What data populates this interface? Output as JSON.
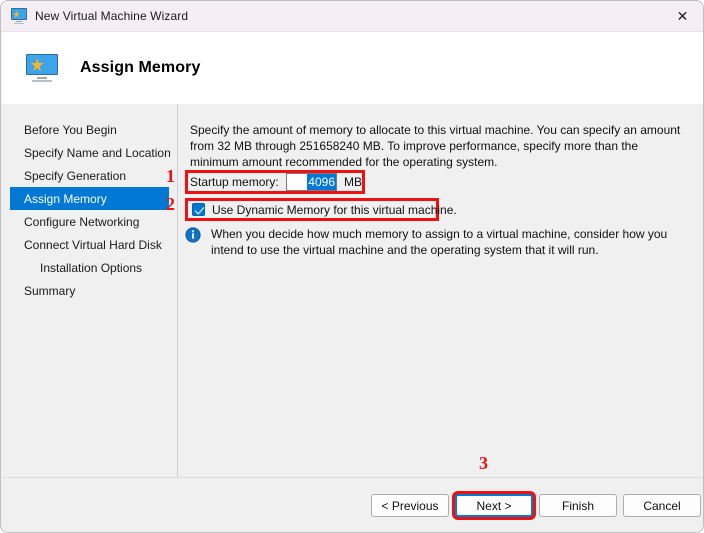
{
  "window": {
    "title": "New Virtual Machine Wizard",
    "title_icon": "virtual-machine-monitor-icon",
    "close_label": "✕"
  },
  "header": {
    "icon": "virtual-machine-monitor-icon",
    "title": "Assign Memory"
  },
  "sidebar": {
    "items": [
      {
        "label": "Before You Begin",
        "selected": false,
        "indent": false
      },
      {
        "label": "Specify Name and Location",
        "selected": false,
        "indent": false
      },
      {
        "label": "Specify Generation",
        "selected": false,
        "indent": false
      },
      {
        "label": "Assign Memory",
        "selected": true,
        "indent": false
      },
      {
        "label": "Configure Networking",
        "selected": false,
        "indent": false
      },
      {
        "label": "Connect Virtual Hard Disk",
        "selected": false,
        "indent": false
      },
      {
        "label": "Installation Options",
        "selected": false,
        "indent": true
      },
      {
        "label": "Summary",
        "selected": false,
        "indent": false
      }
    ]
  },
  "content": {
    "intro": "Specify the amount of memory to allocate to this virtual machine. You can specify an amount from 32 MB through 251658240 MB. To improve performance, specify more than the minimum amount recommended for the operating system.",
    "memory": {
      "label": "Startup memory:",
      "value": "4096",
      "unit": "MB"
    },
    "dynamic_memory": {
      "label": "Use Dynamic Memory for this virtual machine.",
      "checked": true
    },
    "info": {
      "icon": "info-circle-icon",
      "text": "When you decide how much memory to assign to a virtual machine, consider how you intend to use the virtual machine and the operating system that it will run."
    }
  },
  "annotations": {
    "one": "1",
    "two": "2",
    "three": "3",
    "highlight_color": "#ee1111"
  },
  "footer": {
    "previous": "< Previous",
    "next": "Next >",
    "finish": "Finish",
    "cancel": "Cancel"
  },
  "colors": {
    "accent": "#0078d4",
    "titlebar": "#f6eef5",
    "panel": "#f0f0f0"
  }
}
